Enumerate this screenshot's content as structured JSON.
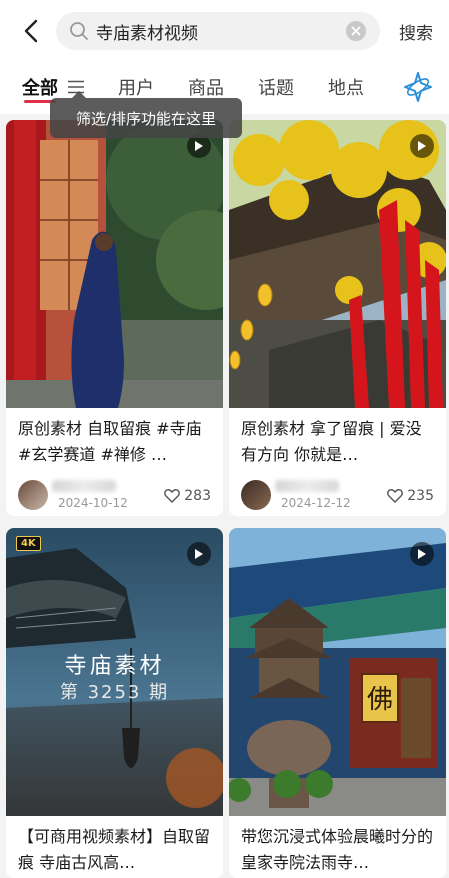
{
  "search": {
    "query": "寺庙素材视频",
    "button_label": "搜索"
  },
  "tabs": [
    {
      "label": "全部",
      "active": true
    },
    {
      "label": "用户"
    },
    {
      "label": "商品"
    },
    {
      "label": "话题"
    },
    {
      "label": "地点"
    }
  ],
  "tooltip": "筛选/排序功能在这里",
  "cards": [
    {
      "title": "原创素材 自取留痕 #寺庙 #玄学赛道 #禅修 …",
      "date": "2024-10-12",
      "likes": "283"
    },
    {
      "title": "原创素材 拿了留痕 | 爱没有方向 你就是…",
      "date": "2024-12-12",
      "likes": "235"
    },
    {
      "title": "【可商用视频素材】自取留痕 寺庙古风高…",
      "badge": "4K",
      "overlay_line1": "寺庙素材",
      "overlay_line2": "第 3253 期"
    },
    {
      "title": "带您沉浸式体验晨曦时分的皇家寺院法雨寺…",
      "sign": "佛"
    }
  ],
  "colors": {
    "accent": "#e0304a",
    "spark": "#2a8fd8"
  }
}
